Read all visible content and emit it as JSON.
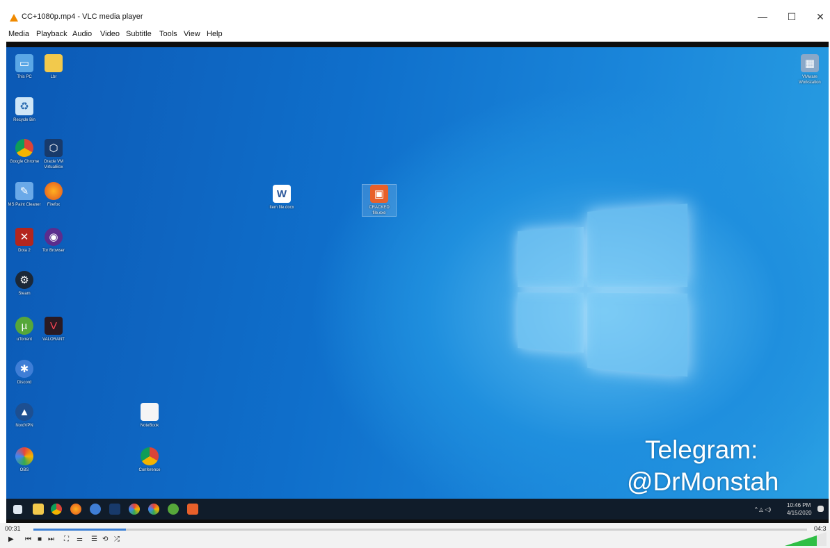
{
  "window": {
    "title": "CC+1080p.mp4 - VLC media player",
    "min": "—",
    "max": "☐",
    "close": "✕"
  },
  "menu": [
    "Media",
    "Playback",
    "Audio",
    "Video",
    "Subtitle",
    "Tools",
    "View",
    "Help"
  ],
  "desktop_icons": [
    {
      "name": "This PC"
    },
    {
      "name": "Lbr"
    },
    {
      "name": "Recycle Bin"
    },
    {
      "name": "Google Chrome"
    },
    {
      "name": "Oracle VM VirtualBox"
    },
    {
      "name": "MS Paint Cleaner"
    },
    {
      "name": "Firefox"
    },
    {
      "name": "Dota 2"
    },
    {
      "name": "Tor Browser"
    },
    {
      "name": "Steam"
    },
    {
      "name": "uTorrent"
    },
    {
      "name": "VALORANT"
    },
    {
      "name": "Discord"
    },
    {
      "name": "NordVPN"
    },
    {
      "name": "NoteBook"
    },
    {
      "name": "OBS"
    },
    {
      "name": "Conference"
    },
    {
      "name": "Item file.docx"
    },
    {
      "name": "CRACKED file.exe"
    },
    {
      "name": "VMware Workstation"
    }
  ],
  "watermark": {
    "line1": "Telegram:",
    "line2": "@DrMonstah"
  },
  "tray": {
    "time": "10:46 PM",
    "date": "4/15/2020"
  },
  "player": {
    "elapsed": "00:31",
    "total": "04:3",
    "progress": 0.12
  },
  "colors": {
    "accent": "#3b7fd4",
    "vlc_orange": "#f08a00",
    "desktop_blue": "#1478d4"
  }
}
